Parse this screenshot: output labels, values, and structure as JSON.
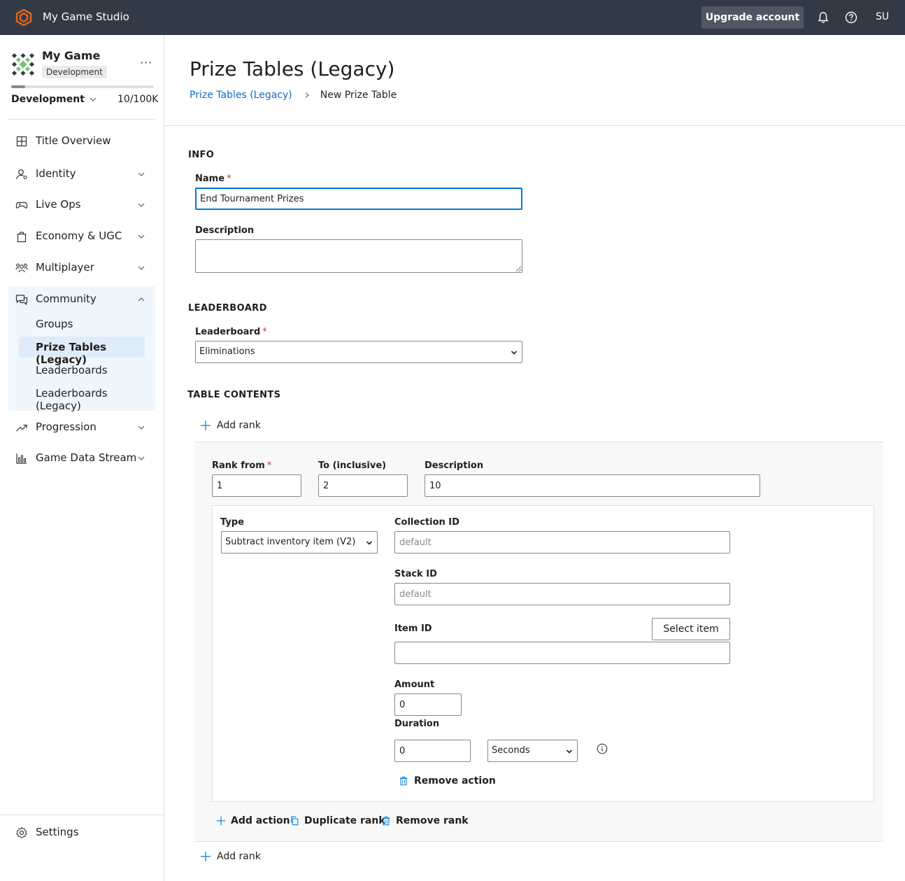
{
  "topbar": {
    "app_title": "My Game Studio",
    "upgrade_label": "Upgrade account",
    "user_initials": "SU"
  },
  "sidebar": {
    "game_name": "My Game",
    "env_badge": "Development",
    "env_select": "Development",
    "usage": "10/100K",
    "usage_fraction": 0.1,
    "nav": [
      {
        "label": "Title Overview",
        "icon": "grid-icon"
      },
      {
        "label": "Identity",
        "icon": "identity-icon"
      },
      {
        "label": "Live Ops",
        "icon": "gamepad-icon"
      },
      {
        "label": "Economy & UGC",
        "icon": "shopping-bag-icon"
      },
      {
        "label": "Multiplayer",
        "icon": "people-icon"
      },
      {
        "label": "Community",
        "icon": "chat-icon"
      },
      {
        "label": "Progression",
        "icon": "trending-icon"
      },
      {
        "label": "Game Data Stream",
        "icon": "bar-chart-icon"
      }
    ],
    "community_items": [
      "Groups",
      "Prize Tables (Legacy)",
      "Leaderboards",
      "Leaderboards (Legacy)"
    ],
    "settings_label": "Settings"
  },
  "main": {
    "title": "Prize Tables (Legacy)",
    "breadcrumb": {
      "link": "Prize Tables (Legacy)",
      "current": "New Prize Table"
    },
    "info": {
      "section": "INFO",
      "name_label": "Name",
      "name_value": "End Tournament Prizes",
      "description_label": "Description",
      "description_value": ""
    },
    "leaderboard": {
      "section": "LEADERBOARD",
      "label": "Leaderboard",
      "value": "Eliminations"
    },
    "table_contents": {
      "section": "TABLE CONTENTS",
      "add_rank": "Add rank",
      "rank_from_label": "Rank from",
      "rank_from_value": "1",
      "to_label": "To (inclusive)",
      "to_value": "2",
      "description_label": "Description",
      "description_value": "10",
      "action": {
        "type_label": "Type",
        "type_value": "Subtract inventory item (V2)",
        "collection_label": "Collection ID",
        "collection_placeholder": "default",
        "stack_label": "Stack ID",
        "stack_placeholder": "default",
        "item_label": "Item ID",
        "select_item": "Select item",
        "item_value": "",
        "amount_label": "Amount",
        "amount_value": "0",
        "duration_label": "Duration",
        "duration_value": "0",
        "duration_unit": "Seconds",
        "remove_action": "Remove action"
      },
      "add_action": "Add action",
      "duplicate_rank": "Duplicate rank",
      "remove_rank": "Remove rank"
    }
  },
  "colors": {
    "topbar": "#323a45",
    "accent": "#0078d4",
    "link": "#106ebe",
    "brand_orange": "#e8661a",
    "required": "#d13438"
  }
}
